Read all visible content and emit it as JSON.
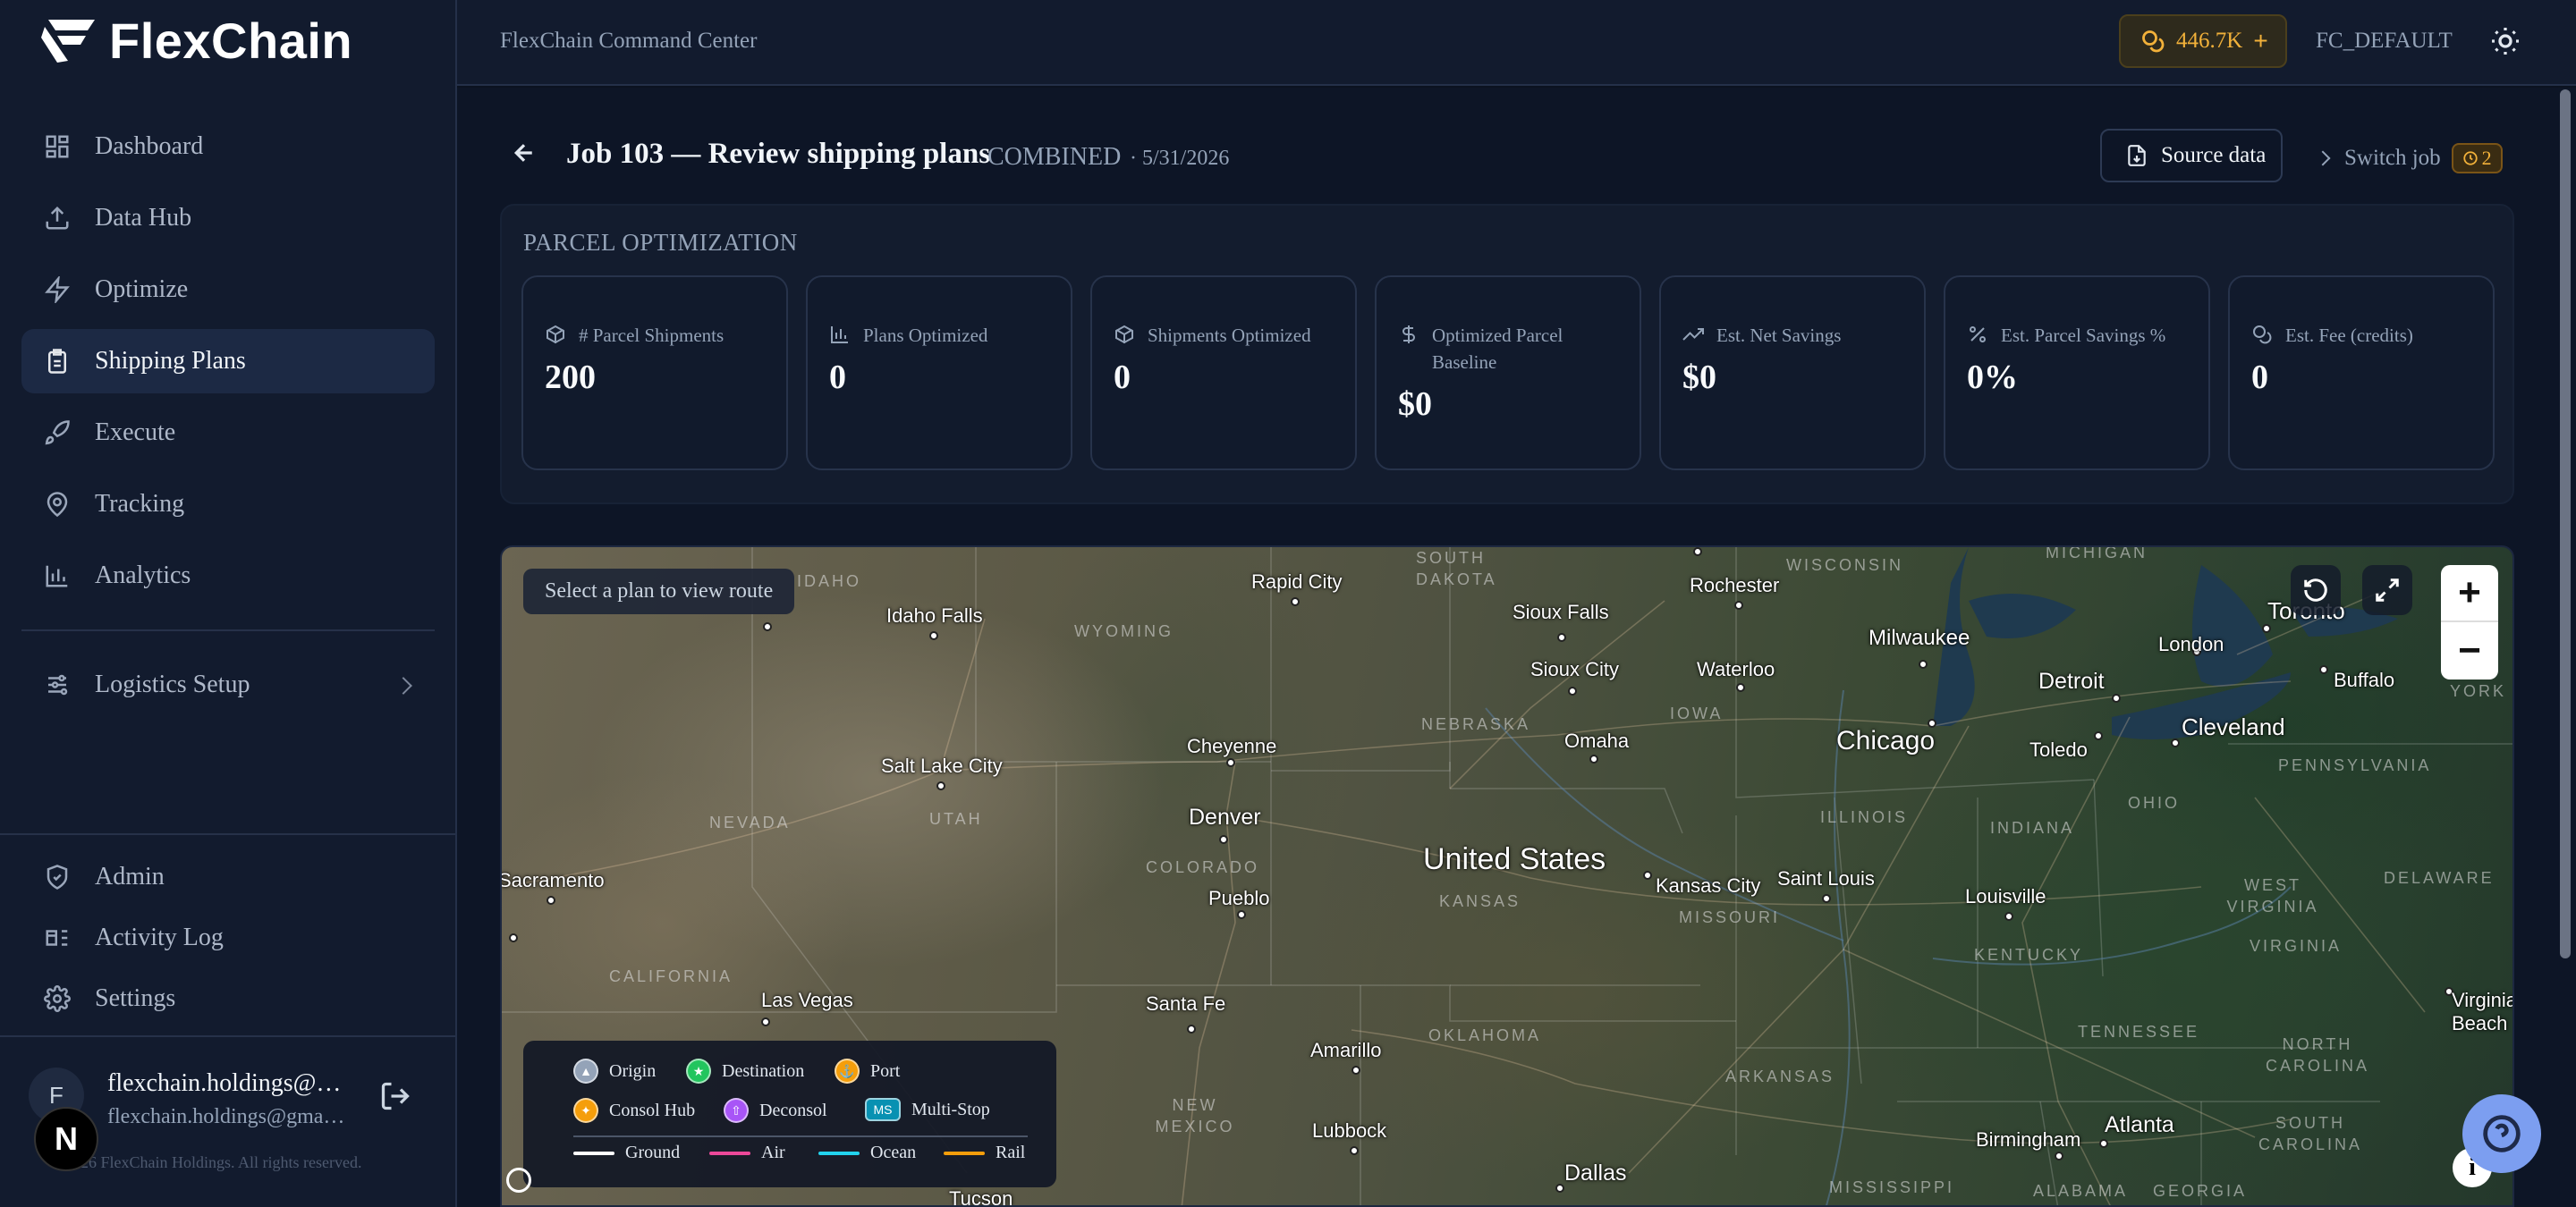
{
  "app": {
    "brand": "FlexChain",
    "command_center": "FlexChain Command Center",
    "credits": "446.7K",
    "account": "FC_DEFAULT"
  },
  "nav": {
    "items": [
      {
        "label": "Dashboard",
        "icon": "dashboard-icon"
      },
      {
        "label": "Data Hub",
        "icon": "upload-icon"
      },
      {
        "label": "Optimize",
        "icon": "bolt-icon"
      },
      {
        "label": "Shipping Plans",
        "icon": "clipboard-icon",
        "active": true
      },
      {
        "label": "Execute",
        "icon": "rocket-icon"
      },
      {
        "label": "Tracking",
        "icon": "map-pin-icon"
      },
      {
        "label": "Analytics",
        "icon": "bar-chart-icon"
      }
    ],
    "logistics_setup": "Logistics Setup",
    "admin": "Admin",
    "activity_log": "Activity Log",
    "settings": "Settings"
  },
  "user": {
    "initial": "F",
    "name": "flexchain.holdings@…",
    "email": "flexchain.holdings@gma…",
    "badge": "N",
    "copyright": "26 FlexChain Holdings. All rights reserved."
  },
  "job": {
    "title": "Job 103 — Review shipping plans",
    "type": "COMBINED",
    "date": "· 5/31/2026",
    "source_data": "Source data",
    "switch_job": "Switch job",
    "switch_count": "2"
  },
  "panel": {
    "title": "PARCEL OPTIMIZATION",
    "cards": [
      {
        "label": "# Parcel Shipments",
        "value": "200",
        "icon": "package-icon"
      },
      {
        "label": "Plans Optimized",
        "value": "0",
        "icon": "bar-chart-icon"
      },
      {
        "label": "Shipments Optimized",
        "value": "0",
        "icon": "package-icon"
      },
      {
        "label": "Optimized Parcel Baseline",
        "value": "$0",
        "icon": "dollar-icon"
      },
      {
        "label": "Est. Net Savings",
        "value": "$0",
        "icon": "trending-up-icon"
      },
      {
        "label": "Est. Parcel Savings %",
        "value": "0%",
        "icon": "percent-icon"
      },
      {
        "label": "Est. Fee (credits)",
        "value": "0",
        "icon": "coins-icon"
      }
    ]
  },
  "map": {
    "hint": "Select a plan to view route",
    "country": "United States",
    "cities": [
      "Idaho Falls",
      "Rapid City",
      "Sioux Falls",
      "Rochester",
      "Milwaukee",
      "Toronto",
      "London",
      "Detroit",
      "Buffalo",
      "Sioux City",
      "Waterloo",
      "Chicago",
      "Cleveland",
      "Toledo",
      "Salt Lake City",
      "Cheyenne",
      "Omaha",
      "Denver",
      "Kansas City",
      "Saint Louis",
      "Louisville",
      "Pueblo",
      "Sacramento",
      "Las Vegas",
      "Santa Fe",
      "Amarillo",
      "Lubbock",
      "Dallas",
      "Birmingham",
      "Atlanta",
      "Virginia Beach",
      "Tucson"
    ],
    "states": [
      "IDAHO",
      "WYOMING",
      "SOUTH DAKOTA",
      "WISCONSIN",
      "MICHIGAN",
      "NEBRASKA",
      "IOWA",
      "NEW YORK",
      "NEVADA",
      "UTAH",
      "COLORADO",
      "KANSAS",
      "MISSOURI",
      "ILLINOIS",
      "INDIANA",
      "OHIO",
      "PENNSYLVANIA",
      "WEST VIRGINIA",
      "DELAWARE",
      "KENTUCKY",
      "VIRGINIA",
      "CALIFORNIA",
      "OKLAHOMA",
      "TENNESSEE",
      "NORTH CAROLINA",
      "ARKANSAS",
      "NEW MEXICO",
      "SOUTH CAROLINA",
      "MISSISSIPPI",
      "ALABAMA",
      "GEORGIA"
    ],
    "legend": {
      "origin": "Origin",
      "destination": "Destination",
      "port": "Port",
      "consol_hub": "Consol Hub",
      "deconsol": "Deconsol",
      "multi_stop": "Multi-Stop",
      "ms": "MS",
      "ground": "Ground",
      "air": "Air",
      "ocean": "Ocean",
      "rail": "Rail"
    },
    "colors": {
      "ground": "#ffffff",
      "air": "#ec4899",
      "ocean": "#22d3ee",
      "rail": "#f59e0b",
      "origin": "#94a3b8",
      "destination": "#22c55e",
      "port": "#f59e0b",
      "consol": "#f59e0b",
      "deconsol": "#a855f7",
      "multistop": "#0891b2"
    },
    "zoom_in": "+",
    "zoom_out": "−"
  }
}
